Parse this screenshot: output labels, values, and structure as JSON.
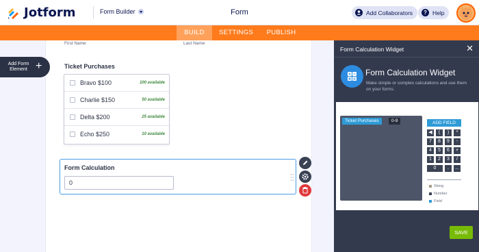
{
  "header": {
    "brand": "Jotform",
    "builder_dropdown": "Form Builder",
    "form_title": "Form",
    "add_collaborators": "Add Collaborators",
    "help": "Help"
  },
  "tabs": [
    {
      "label": "BUILD",
      "active": true
    },
    {
      "label": "SETTINGS",
      "active": false
    },
    {
      "label": "PUBLISH",
      "active": false
    }
  ],
  "add_form_element": {
    "label": "Add Form Element",
    "icon": "plus-icon"
  },
  "form": {
    "sublabels": {
      "first": "First Name",
      "last": "Last Name"
    },
    "ticket_field": {
      "label": "Ticket Purchases",
      "options": [
        {
          "name": "Bravo $100",
          "available": "100 available"
        },
        {
          "name": "Charlie $150",
          "available": "50 available"
        },
        {
          "name": "Delta $200",
          "available": "25 available"
        },
        {
          "name": "Echo $250",
          "available": "10 available"
        }
      ]
    },
    "calc_field": {
      "label": "Form Calculation",
      "value": "0"
    }
  },
  "field_tools": [
    {
      "icon": "pencil-icon",
      "color": "#3a4254"
    },
    {
      "icon": "gear-icon",
      "color": "#3a4254"
    },
    {
      "icon": "trash-icon",
      "color": "#e03a3e"
    }
  ],
  "panel": {
    "header_title": "Form Calculation Widget",
    "close_icon": "close-icon",
    "widget_title": "Form Calculation Widget",
    "widget_description": "Make simple or complex calculations and use them on your forms.",
    "editor": {
      "field_tag": "Ticket Purchases",
      "range_tag": "0-9",
      "add_field": "ADD FIELD",
      "keys": [
        "◀",
        "(",
        ")",
        "*",
        "7",
        "8",
        "9",
        "-",
        "4",
        "5",
        "6",
        "+",
        "1",
        "2",
        "3",
        "/",
        "0",
        ".",
        "..."
      ],
      "legend": [
        {
          "label": "String",
          "color": "#a89a86"
        },
        {
          "label": "Number",
          "color": "#3a4254"
        },
        {
          "label": "Field",
          "color": "#2f9bd6"
        }
      ]
    },
    "save": "SAVE"
  },
  "colors": {
    "brand_orange": "#ff7b1c",
    "accent_blue": "#2f9bd6",
    "save_green": "#78bb07",
    "panel_bg": "#333a4e"
  }
}
